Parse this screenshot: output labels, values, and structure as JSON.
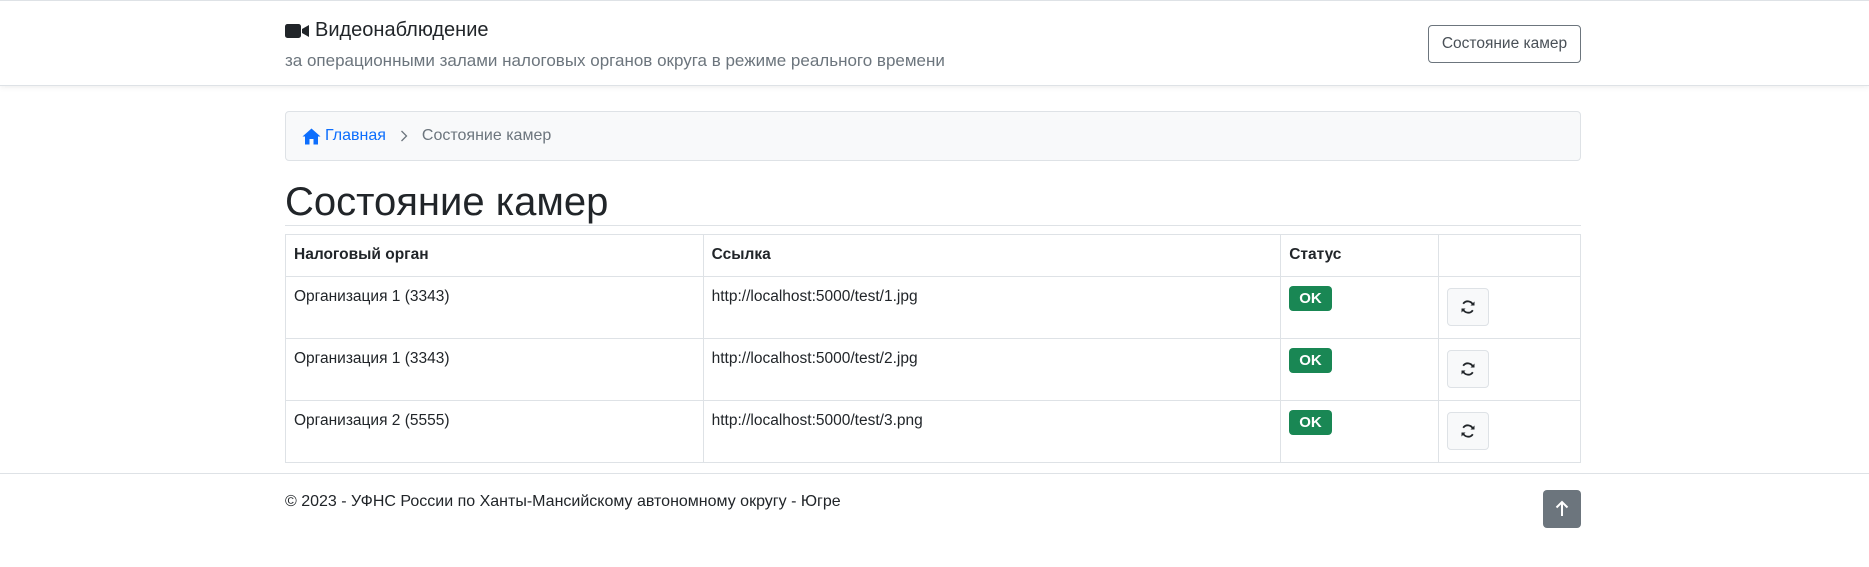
{
  "header": {
    "brand_icon": "video-camera-icon",
    "title": "Видеонаблюдение",
    "subtitle": "за операционными залами налоговых органов округа в режиме реального времени",
    "nav_button": "Состояние камер"
  },
  "breadcrumb": {
    "home_icon": "home-icon",
    "home": "Главная",
    "current": "Состояние камер"
  },
  "page": {
    "title": "Состояние камер"
  },
  "table": {
    "columns": [
      "Налоговый орган",
      "Ссылка",
      "Статус",
      ""
    ],
    "rows": [
      {
        "organ": "Организация 1 (3343)",
        "link": "http://localhost:5000/test/1.jpg",
        "status": "OK"
      },
      {
        "organ": "Организация 1 (3343)",
        "link": "http://localhost:5000/test/2.jpg",
        "status": "OK"
      },
      {
        "organ": "Организация 2 (5555)",
        "link": "http://localhost:5000/test/3.png",
        "status": "OK"
      }
    ],
    "row_action_icon": "refresh-icon"
  },
  "footer": {
    "text": "© 2023 - УФНС России по Ханты-Мансийскому автономному округу - Югре",
    "top_button_icon": "arrow-up-icon"
  },
  "colors": {
    "link": "#0d6efd",
    "status_ok": "#198754",
    "muted": "#6c757d"
  }
}
